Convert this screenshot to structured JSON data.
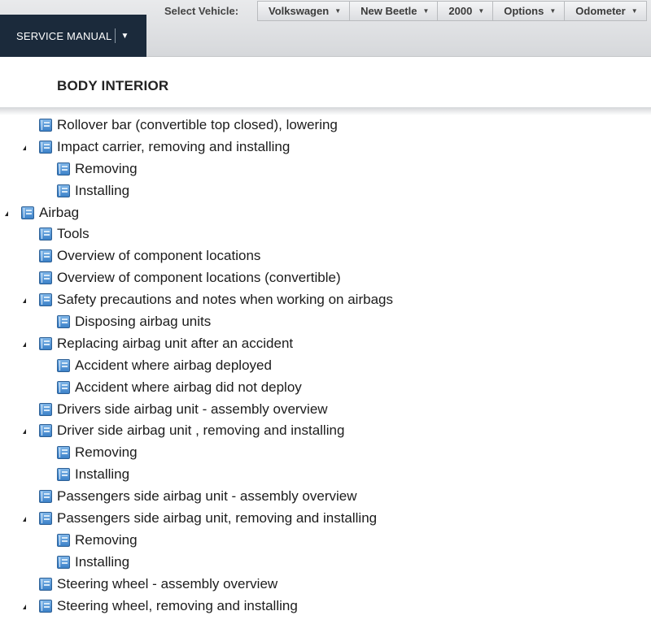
{
  "header": {
    "brand_label": "SERVICE MANUAL",
    "select_vehicle_label": "Select Vehicle:",
    "selectors": [
      "Volkswagen",
      "New Beetle",
      "2000",
      "Options",
      "Odometer"
    ]
  },
  "page": {
    "title": "BODY INTERIOR"
  },
  "tree": [
    {
      "label": "Rollover bar (convertible top closed), lowering",
      "level": 1,
      "expanded": false
    },
    {
      "label": "Impact carrier, removing and installing",
      "level": 1,
      "expanded": true
    },
    {
      "label": "Removing",
      "level": 2,
      "expanded": false
    },
    {
      "label": "Installing",
      "level": 2,
      "expanded": false
    },
    {
      "label": "Airbag",
      "level": 0,
      "expanded": true
    },
    {
      "label": "Tools",
      "level": 1,
      "expanded": false
    },
    {
      "label": "Overview of component locations",
      "level": 1,
      "expanded": false
    },
    {
      "label": "Overview of component locations (convertible)",
      "level": 1,
      "expanded": false
    },
    {
      "label": "Safety precautions and notes when working on airbags",
      "level": 1,
      "expanded": true
    },
    {
      "label": "Disposing airbag units",
      "level": 2,
      "expanded": false
    },
    {
      "label": "Replacing airbag unit after an accident",
      "level": 1,
      "expanded": true
    },
    {
      "label": "Accident where airbag deployed",
      "level": 2,
      "expanded": false
    },
    {
      "label": "Accident where airbag did not deploy",
      "level": 2,
      "expanded": false
    },
    {
      "label": "Drivers side airbag unit - assembly overview",
      "level": 1,
      "expanded": false
    },
    {
      "label": "Driver side airbag unit , removing and installing",
      "level": 1,
      "expanded": true
    },
    {
      "label": "Removing",
      "level": 2,
      "expanded": false
    },
    {
      "label": "Installing",
      "level": 2,
      "expanded": false
    },
    {
      "label": "Passengers side airbag unit - assembly overview",
      "level": 1,
      "expanded": false
    },
    {
      "label": "Passengers side airbag unit, removing and installing",
      "level": 1,
      "expanded": true
    },
    {
      "label": "Removing",
      "level": 2,
      "expanded": false
    },
    {
      "label": "Installing",
      "level": 2,
      "expanded": false
    },
    {
      "label": "Steering wheel - assembly overview",
      "level": 1,
      "expanded": false
    },
    {
      "label": "Steering wheel, removing and installing",
      "level": 1,
      "expanded": true
    }
  ]
}
